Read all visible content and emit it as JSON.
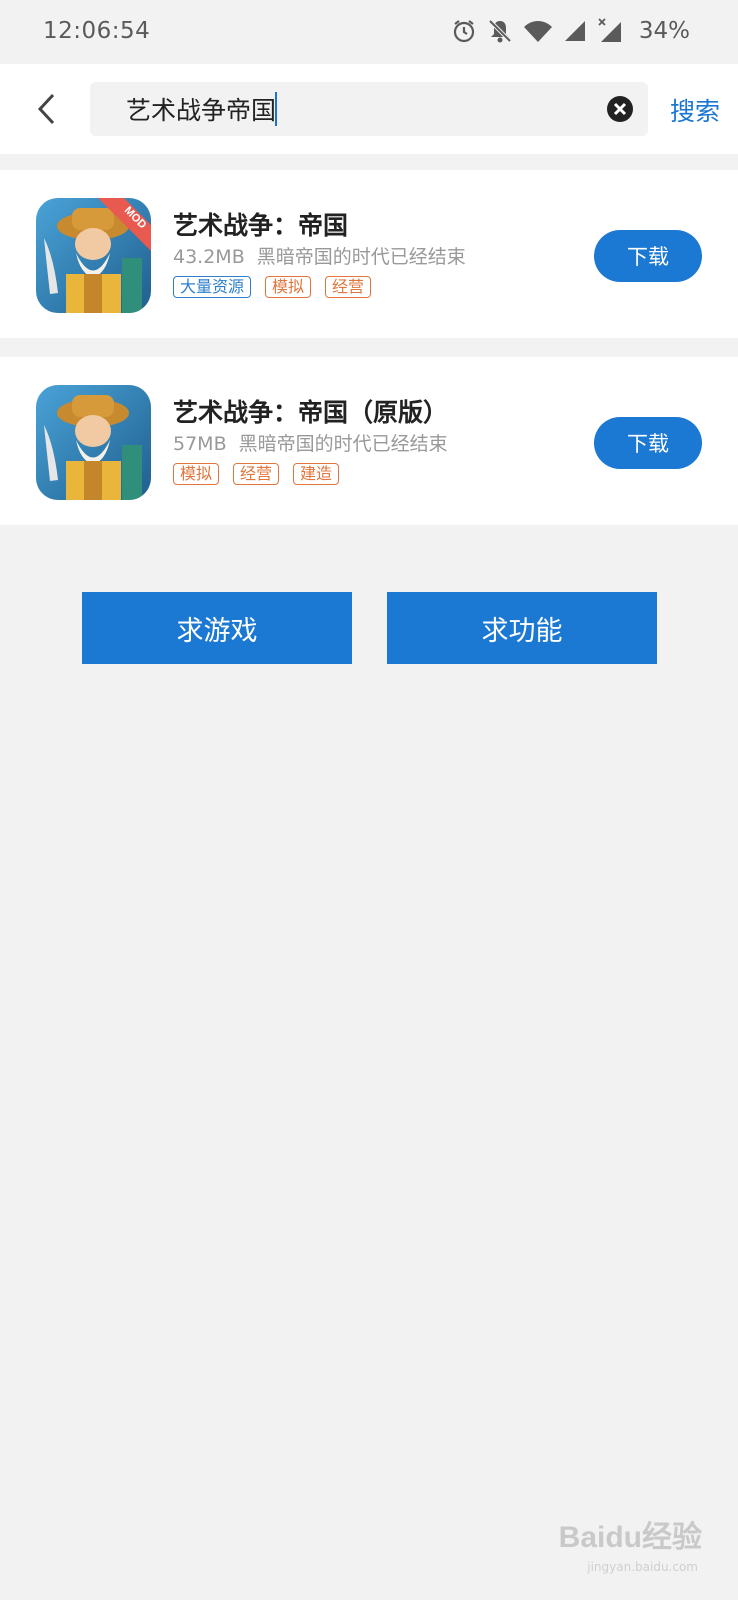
{
  "status_bar": {
    "time": "12:06:54",
    "icons": [
      "alarm-icon",
      "notifications-off-icon",
      "wifi-icon",
      "signal-icon",
      "signal-no-data-icon"
    ],
    "battery": "34%"
  },
  "search": {
    "query": "艺术战争帝国",
    "button_label": "搜索"
  },
  "results": [
    {
      "title": "艺术战争：帝国",
      "size": "43.2MB",
      "description": "黑暗帝国的时代已经结束",
      "badge": "MOD",
      "tags": [
        "大量资源",
        "模拟",
        "经营"
      ],
      "download_label": "下载"
    },
    {
      "title": "艺术战争：帝国（原版）",
      "size": "57MB",
      "description": "黑暗帝国的时代已经结束",
      "tags": [
        "模拟",
        "经营",
        "建造"
      ],
      "download_label": "下载"
    }
  ],
  "actions": {
    "request_game": "求游戏",
    "request_feature": "求功能"
  },
  "watermark": {
    "text": "Baidu经验",
    "url": "jingyan.baidu.com"
  },
  "colors": {
    "accent": "#1b78d3",
    "tag_orange": "#e0763d",
    "tag_blue": "#2f7fce",
    "background": "#f2f2f2"
  }
}
